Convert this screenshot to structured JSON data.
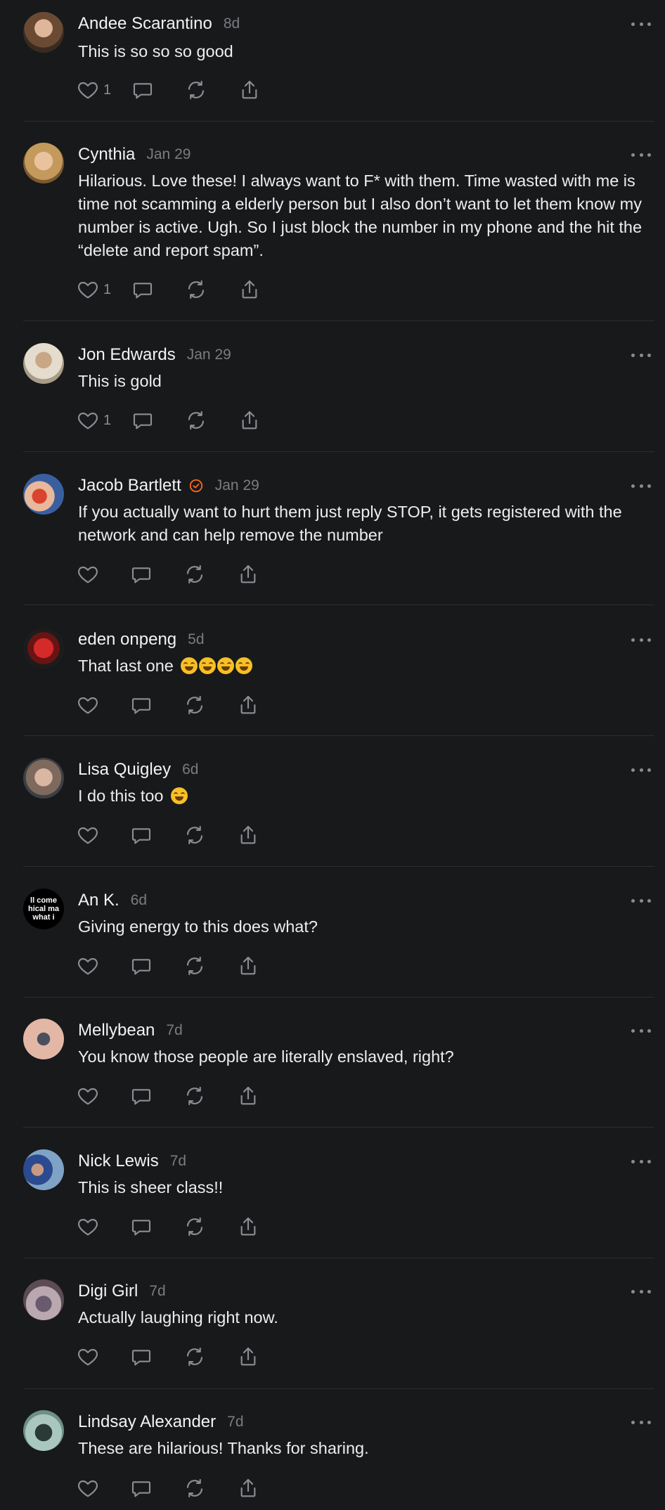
{
  "colors": {
    "background": "#18191b",
    "text": "#f2f2f2",
    "muted": "#7b7c80",
    "divider": "#2c2d31",
    "verified": "#ff6719"
  },
  "icons": {
    "like": "heart-icon",
    "comment": "comment-icon",
    "restack": "restack-icon",
    "share": "share-icon",
    "more": "more-icon"
  },
  "comments": [
    {
      "name": "Andee Scarantino",
      "time": "8d",
      "body": "This is so so so good",
      "likes": "1"
    },
    {
      "name": "Cynthia",
      "time": "Jan 29",
      "body": "Hilarious. Love these! I always want to F* with them. Time wasted with me is time not scamming a elderly person but I also don’t want to let them know my number is active. Ugh. So I just block the number in my phone and the hit the “delete and report spam”.",
      "likes": "1"
    },
    {
      "name": "Jon Edwards",
      "time": "Jan 29",
      "body": "This is gold",
      "likes": "1"
    },
    {
      "name": "Jacob Bartlett",
      "time": "Jan 29",
      "body": "If you actually want to hurt them just reply STOP, it gets registered with the network and can help remove the number",
      "likes": ""
    },
    {
      "name": "eden onpeng",
      "time": "5d",
      "body": "That last one",
      "likes": ""
    },
    {
      "name": "Lisa Quigley",
      "time": "6d",
      "body": "I do this too",
      "likes": ""
    },
    {
      "name": "An K.",
      "time": "6d",
      "body": "Giving energy to this does what?",
      "likes": "",
      "avatar_text": "ll come hical ma what i"
    },
    {
      "name": "Mellybean",
      "time": "7d",
      "body": "You know those people are literally enslaved, right?",
      "likes": ""
    },
    {
      "name": "Nick Lewis",
      "time": "7d",
      "body": "This is sheer class!!",
      "likes": ""
    },
    {
      "name": "Digi Girl",
      "time": "7d",
      "body": "Actually laughing right now.",
      "likes": ""
    },
    {
      "name": "Lindsay Alexander",
      "time": "7d",
      "body": "These are hilarious! Thanks for sharing.",
      "likes": ""
    }
  ]
}
